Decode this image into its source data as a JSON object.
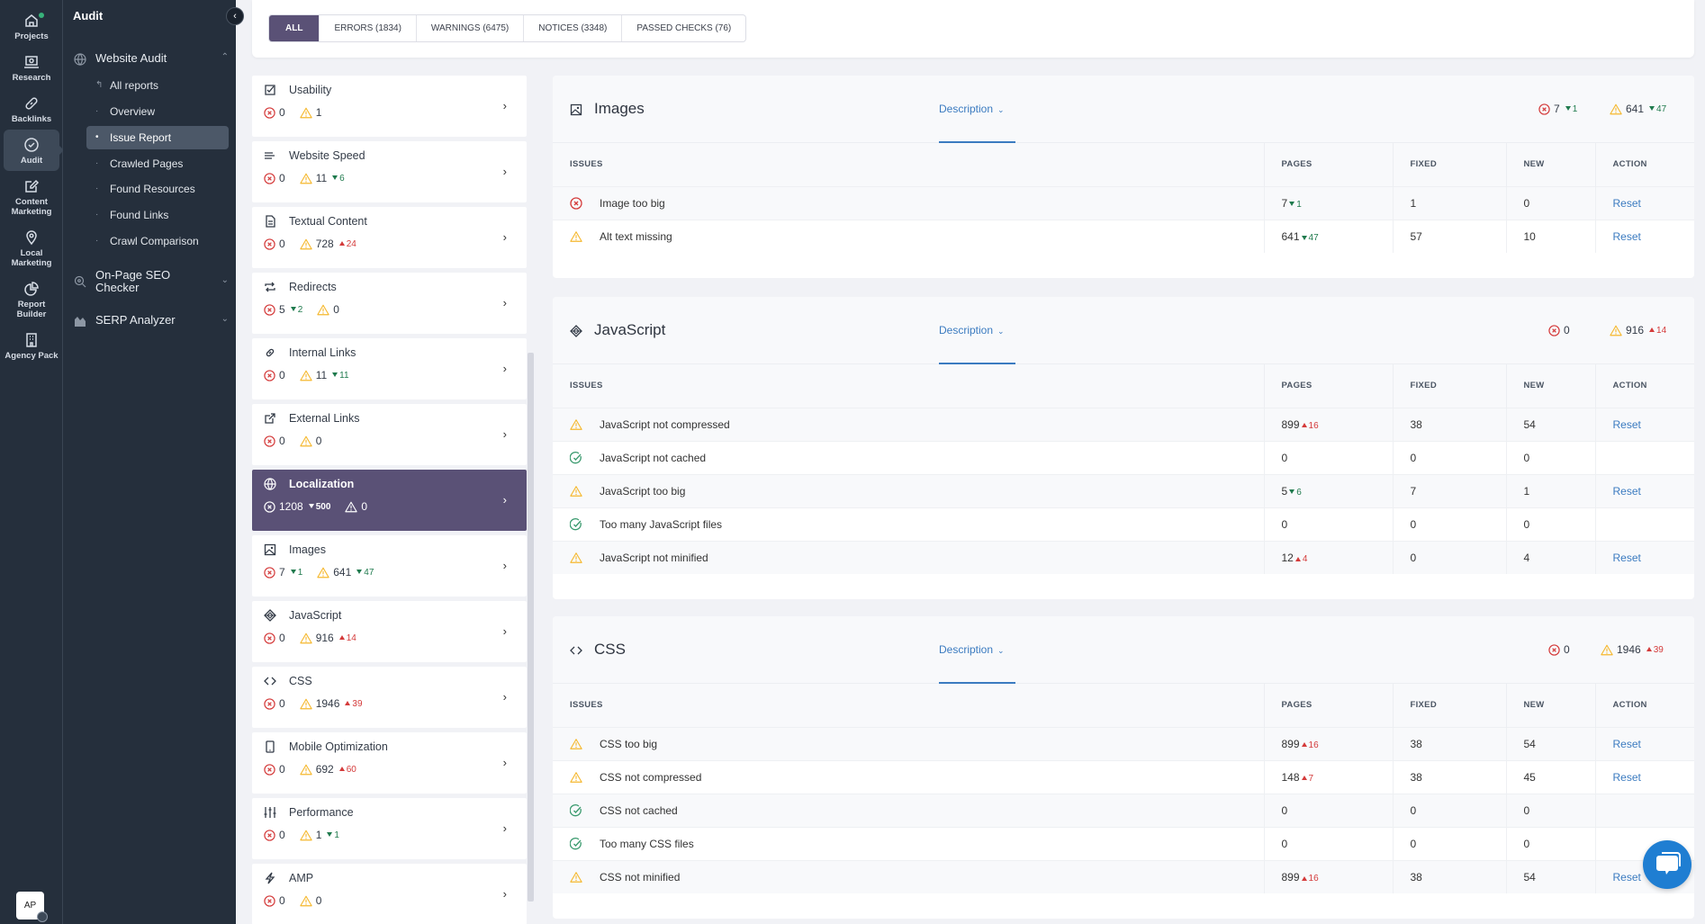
{
  "rail": {
    "items": [
      {
        "label": "Projects",
        "icon": "home-icon"
      },
      {
        "label": "Research",
        "icon": "laptop-search-icon"
      },
      {
        "label": "Backlinks",
        "icon": "link-icon"
      },
      {
        "label": "Audit",
        "icon": "check-circle-icon"
      },
      {
        "label": "Content Marketing",
        "icon": "edit-icon"
      },
      {
        "label": "Local Marketing",
        "icon": "location-pin-icon"
      },
      {
        "label": "Report Builder",
        "icon": "pie-chart-icon"
      },
      {
        "label": "Agency Pack",
        "icon": "building-icon"
      }
    ],
    "active": "Audit",
    "avatar_initials": "AP"
  },
  "submenu": {
    "title": "Audit",
    "website_audit": "Website Audit",
    "items": [
      {
        "label": "All reports"
      },
      {
        "label": "Overview"
      },
      {
        "label": "Issue Report"
      },
      {
        "label": "Crawled Pages"
      },
      {
        "label": "Found Resources"
      },
      {
        "label": "Found Links"
      },
      {
        "label": "Crawl Comparison"
      }
    ],
    "active": "Issue Report",
    "on_page_seo_line1": "On-Page SEO",
    "on_page_seo_line2": "Checker",
    "serp_analyzer": "SERP Analyzer"
  },
  "filters": {
    "tabs": [
      {
        "label": "ALL"
      },
      {
        "label": "ERRORS (1834)"
      },
      {
        "label": "WARNINGS (6475)"
      },
      {
        "label": "NOTICES (3348)"
      },
      {
        "label": "PASSED CHECKS (76)"
      }
    ],
    "active": "ALL"
  },
  "categories": [
    {
      "name": "Usability",
      "errors": "0",
      "warnings": "1"
    },
    {
      "name": "Website Speed",
      "errors": "0",
      "warnings": "11",
      "warnings_delta": "6",
      "warnings_dir": "down"
    },
    {
      "name": "Textual Content",
      "errors": "0",
      "warnings": "728",
      "warnings_delta": "24",
      "warnings_dir": "up"
    },
    {
      "name": "Redirects",
      "errors": "5",
      "errors_delta": "2",
      "errors_dir": "down",
      "warnings": "0"
    },
    {
      "name": "Internal Links",
      "errors": "0",
      "warnings": "11",
      "warnings_delta": "11",
      "warnings_dir": "down"
    },
    {
      "name": "External Links",
      "errors": "0",
      "warnings": "0"
    },
    {
      "name": "Localization",
      "errors": "1208",
      "errors_delta": "500",
      "errors_dir": "down",
      "warnings": "0",
      "active": true
    },
    {
      "name": "Images",
      "errors": "7",
      "errors_delta": "1",
      "errors_dir": "down",
      "warnings": "641",
      "warnings_delta": "47",
      "warnings_dir": "down"
    },
    {
      "name": "JavaScript",
      "errors": "0",
      "warnings": "916",
      "warnings_delta": "14",
      "warnings_dir": "up"
    },
    {
      "name": "CSS",
      "errors": "0",
      "warnings": "1946",
      "warnings_delta": "39",
      "warnings_dir": "up"
    },
    {
      "name": "Mobile Optimization",
      "errors": "0",
      "warnings": "692",
      "warnings_delta": "60",
      "warnings_dir": "up"
    },
    {
      "name": "Performance",
      "errors": "0",
      "warnings": "1",
      "warnings_delta": "1",
      "warnings_dir": "down"
    },
    {
      "name": "AMP",
      "errors": "0",
      "warnings": "0"
    }
  ],
  "table_headers": {
    "issues": "ISSUES",
    "pages": "PAGES",
    "fixed": "FIXED",
    "new": "NEW",
    "action": "ACTION"
  },
  "description_label": "Description",
  "reset_label": "Reset",
  "sections": [
    {
      "title": "Images",
      "summary": {
        "errors": "7",
        "errors_delta": "1",
        "errors_dir": "down",
        "warnings": "641",
        "warnings_delta": "47",
        "warnings_dir": "down"
      },
      "rows": [
        {
          "status": "error",
          "issue": "Image too big",
          "pages": "7",
          "pages_delta": "1",
          "pages_dir": "down",
          "fixed": "1",
          "new": "0",
          "action": true
        },
        {
          "status": "warning",
          "issue": "Alt text missing",
          "pages": "641",
          "pages_delta": "47",
          "pages_dir": "down",
          "fixed": "57",
          "new": "10",
          "action": true
        }
      ]
    },
    {
      "title": "JavaScript",
      "summary": {
        "errors": "0",
        "warnings": "916",
        "warnings_delta": "14",
        "warnings_dir": "up"
      },
      "rows": [
        {
          "status": "warning",
          "issue": "JavaScript not compressed",
          "pages": "899",
          "pages_delta": "16",
          "pages_dir": "up",
          "fixed": "38",
          "new": "54",
          "action": true
        },
        {
          "status": "passed",
          "issue": "JavaScript not cached",
          "pages": "0",
          "fixed": "0",
          "new": "0",
          "action": false
        },
        {
          "status": "warning",
          "issue": "JavaScript too big",
          "pages": "5",
          "pages_delta": "6",
          "pages_dir": "down",
          "fixed": "7",
          "new": "1",
          "action": true
        },
        {
          "status": "passed",
          "issue": "Too many JavaScript files",
          "pages": "0",
          "fixed": "0",
          "new": "0",
          "action": false
        },
        {
          "status": "warning",
          "issue": "JavaScript not minified",
          "pages": "12",
          "pages_delta": "4",
          "pages_dir": "up",
          "fixed": "0",
          "new": "4",
          "action": true
        }
      ]
    },
    {
      "title": "CSS",
      "summary": {
        "errors": "0",
        "warnings": "1946",
        "warnings_delta": "39",
        "warnings_dir": "up"
      },
      "rows": [
        {
          "status": "warning",
          "issue": "CSS too big",
          "pages": "899",
          "pages_delta": "16",
          "pages_dir": "up",
          "fixed": "38",
          "new": "54",
          "action": true
        },
        {
          "status": "warning",
          "issue": "CSS not compressed",
          "pages": "148",
          "pages_delta": "7",
          "pages_dir": "up",
          "fixed": "38",
          "new": "45",
          "action": true
        },
        {
          "status": "passed",
          "issue": "CSS not cached",
          "pages": "0",
          "fixed": "0",
          "new": "0",
          "action": false
        },
        {
          "status": "passed",
          "issue": "Too many CSS files",
          "pages": "0",
          "fixed": "0",
          "new": "0",
          "action": false
        },
        {
          "status": "warning",
          "issue": "CSS not minified",
          "pages": "899",
          "pages_delta": "16",
          "pages_dir": "up",
          "fixed": "38",
          "new": "54",
          "action": true
        }
      ]
    }
  ],
  "colors": {
    "accent": "#5a5176",
    "link": "#3b7bc0",
    "error": "#d43a3a",
    "warning": "#f5b82e",
    "passed": "#3a9a6e",
    "delta_down": "#1f7a4d",
    "delta_up": "#d43a3a",
    "rail_bg": "#252f3c",
    "chat": "#1f7ed2"
  }
}
